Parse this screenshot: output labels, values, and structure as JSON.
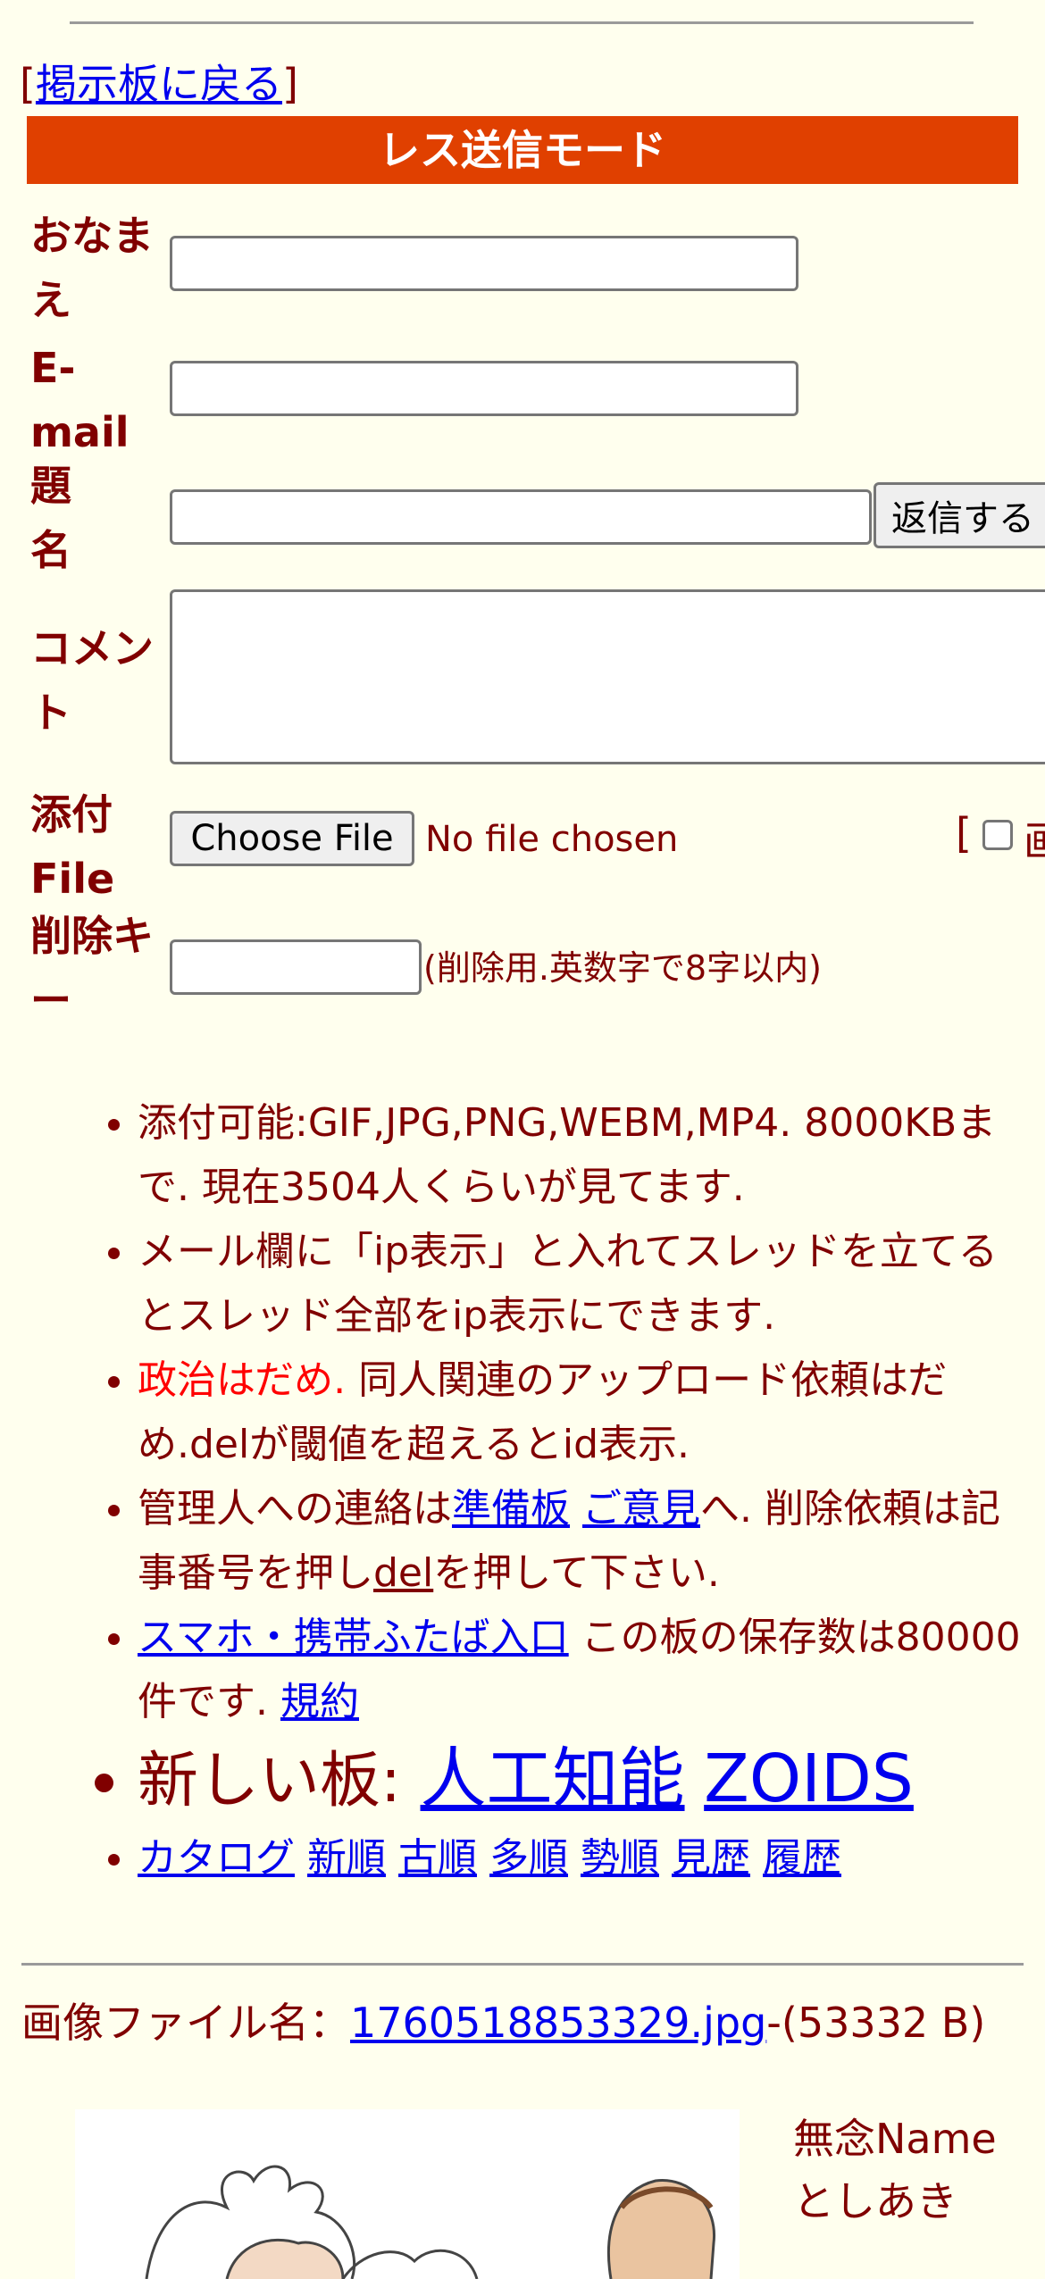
{
  "nav": {
    "open_bracket": "[",
    "back_link": "掲示板に戻る",
    "close_bracket": "]"
  },
  "form": {
    "title": "レス送信モード",
    "name_label": "おなまえ",
    "name_value": "",
    "email_label": "E-mail",
    "email_value": "",
    "subject_label": "題名",
    "subject_value": "",
    "submit_label": "返信する",
    "comment_label": "コメント",
    "comment_value": "",
    "file_label": "添付File",
    "file_button": "Choose File",
    "file_status": "No file chosen",
    "textonly_bracket": "[",
    "textonly_label": "画",
    "delkey_label": "削除キー",
    "delkey_value": "",
    "delkey_hint": "(削除用.英数字で8字以内)"
  },
  "notes": {
    "n1": "添付可能:GIF,JPG,PNG,WEBM,MP4. 8000KBまで. 現在3504人くらいが見てます.",
    "n2": "メール欄に「ip表示」と入れてスレッドを立てるとスレッド全部をip表示にできます.",
    "n3_red": "政治はだめ.",
    "n3_rest": " 同人関連のアップロード依頼はだめ.delが閾値を超えるとid表示.",
    "n4_a": "管理人への連絡は",
    "n4_link1": "準備板",
    "n4_link2": "ご意見",
    "n4_b": "へ. 削除依頼は記事番号を押し",
    "n4_link3": "del",
    "n4_c": "を押して下さい.",
    "n5_link": "スマホ・携帯ふたば入口",
    "n5_text": " この板の保存数は80000件です. ",
    "n5_link2": "規約",
    "n6_text": "新しい板: ",
    "n6_link1": "人工知能",
    "n6_link2": "ZOIDS",
    "links": [
      "カタログ",
      "新順",
      "古順",
      "多順",
      "勢順",
      "見歴",
      "履歴"
    ]
  },
  "post": {
    "file_prefix": "画像ファイル名：",
    "file_link": "1760518853329.jpg",
    "file_size": "-(53332 B)",
    "name": "無念Name",
    "poster": "としあき"
  },
  "colors": {
    "banner": "#e04000",
    "text": "#800000",
    "link": "#0000ee",
    "background": "#ffffee"
  }
}
